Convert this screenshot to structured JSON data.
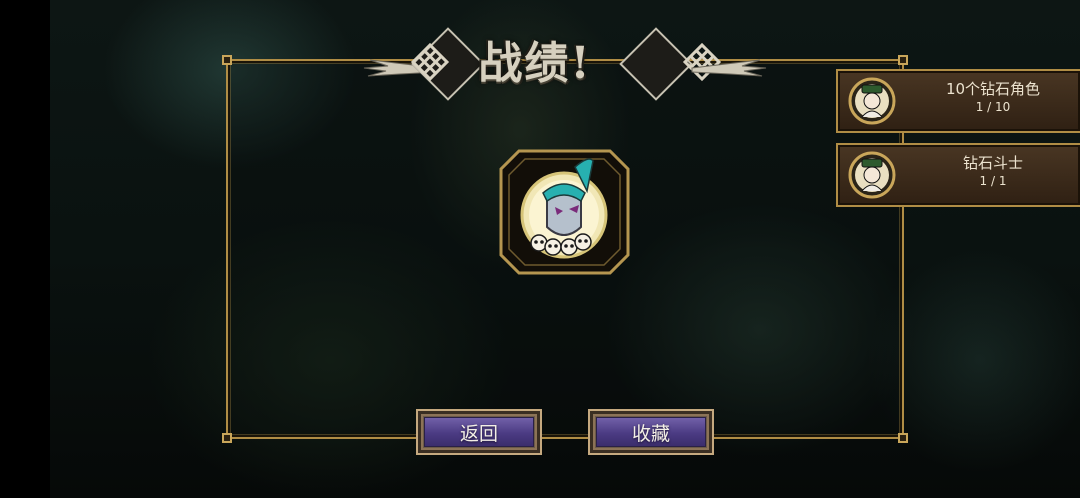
{
  "screen": {
    "title": "战绩!"
  },
  "achievements": [
    {
      "name": "10个钻石角色",
      "progress": "1 / 10",
      "icon": "character-portrait-icon"
    },
    {
      "name": "钻石斗士",
      "progress": "1 / 1",
      "icon": "character-portrait-icon"
    }
  ],
  "medal": {
    "icon": "skull-character-medal-icon"
  },
  "buttons": {
    "back_label": "返回",
    "collect_label": "收藏"
  },
  "colors": {
    "gold_border": "#b08d45",
    "button_purple": "#4b3b83",
    "card_brown": "#3a2917"
  }
}
